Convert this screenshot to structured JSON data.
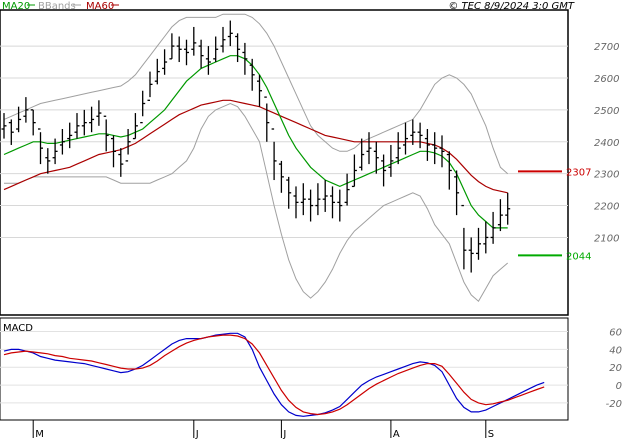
{
  "header": {
    "legend": [
      {
        "name": "MA20",
        "color": "#009900"
      },
      {
        "name": "BBands",
        "color": "#a0a0a0"
      },
      {
        "name": "MA60",
        "color": "#aa0000"
      }
    ],
    "copyright": "© TEC 8/9/2024 3:0 GMT"
  },
  "chart_data": [
    {
      "type": "line",
      "subtype": "ohlc",
      "x": [
        "M",
        "J",
        "J",
        "A",
        "S"
      ],
      "x_label_positions": [
        4,
        26,
        38,
        53,
        66
      ],
      "n_bars": 70,
      "ylim": [
        1860,
        2810
      ],
      "y_ticks": [
        2100,
        2200,
        2300,
        2400,
        2500,
        2600,
        2700
      ],
      "y_tick_labels": [
        "2100",
        "2200",
        "2300",
        "2400",
        "2500",
        "2600",
        "2700"
      ],
      "close": [
        2450,
        2430,
        2470,
        2500,
        2460,
        2380,
        2340,
        2370,
        2400,
        2420,
        2450,
        2460,
        2470,
        2490,
        2420,
        2370,
        2330,
        2400,
        2450,
        2520,
        2580,
        2620,
        2650,
        2700,
        2690,
        2680,
        2710,
        2670,
        2650,
        2690,
        2720,
        2740,
        2690,
        2660,
        2610,
        2560,
        2460,
        2340,
        2290,
        2240,
        2210,
        2220,
        2200,
        2220,
        2230,
        2210,
        2200,
        2250,
        2310,
        2360,
        2380,
        2350,
        2310,
        2340,
        2380,
        2410,
        2430,
        2420,
        2390,
        2380,
        2370,
        2310,
        2240,
        2060,
        2050,
        2080,
        2100,
        2130,
        2170,
        2190
      ],
      "high": [
        2490,
        2470,
        2510,
        2540,
        2500,
        2430,
        2380,
        2410,
        2440,
        2460,
        2490,
        2500,
        2510,
        2530,
        2470,
        2420,
        2380,
        2440,
        2490,
        2560,
        2620,
        2660,
        2690,
        2740,
        2730,
        2720,
        2760,
        2720,
        2700,
        2730,
        2760,
        2780,
        2740,
        2710,
        2660,
        2610,
        2520,
        2400,
        2340,
        2290,
        2260,
        2270,
        2250,
        2270,
        2280,
        2260,
        2250,
        2300,
        2360,
        2410,
        2430,
        2400,
        2360,
        2390,
        2430,
        2460,
        2470,
        2460,
        2440,
        2430,
        2420,
        2370,
        2310,
        2130,
        2100,
        2130,
        2150,
        2180,
        2220,
        2240
      ],
      "low": [
        2410,
        2390,
        2430,
        2460,
        2420,
        2330,
        2300,
        2330,
        2360,
        2380,
        2410,
        2420,
        2430,
        2450,
        2370,
        2320,
        2290,
        2360,
        2410,
        2480,
        2540,
        2580,
        2610,
        2660,
        2650,
        2640,
        2670,
        2630,
        2610,
        2650,
        2680,
        2700,
        2650,
        2610,
        2560,
        2510,
        2400,
        2280,
        2240,
        2190,
        2160,
        2170,
        2150,
        2170,
        2180,
        2160,
        2150,
        2200,
        2260,
        2310,
        2330,
        2300,
        2260,
        2290,
        2330,
        2360,
        2390,
        2380,
        2340,
        2330,
        2320,
        2250,
        2170,
        2000,
        1990,
        2030,
        2050,
        2080,
        2120,
        2140
      ],
      "open": [
        2440,
        2460,
        2440,
        2480,
        2500,
        2440,
        2350,
        2350,
        2390,
        2410,
        2430,
        2450,
        2460,
        2480,
        2480,
        2410,
        2360,
        2340,
        2410,
        2460,
        2530,
        2590,
        2630,
        2660,
        2700,
        2690,
        2690,
        2700,
        2660,
        2660,
        2700,
        2730,
        2730,
        2680,
        2640,
        2590,
        2540,
        2440,
        2330,
        2280,
        2230,
        2210,
        2220,
        2200,
        2220,
        2230,
        2210,
        2210,
        2260,
        2320,
        2370,
        2370,
        2340,
        2320,
        2350,
        2390,
        2420,
        2430,
        2410,
        2390,
        2380,
        2360,
        2290,
        2200,
        2060,
        2050,
        2080,
        2100,
        2140,
        2170
      ],
      "ma20": [
        2360,
        2370,
        2380,
        2390,
        2400,
        2400,
        2395,
        2395,
        2400,
        2405,
        2410,
        2415,
        2420,
        2425,
        2425,
        2420,
        2415,
        2420,
        2430,
        2440,
        2460,
        2480,
        2500,
        2530,
        2560,
        2590,
        2610,
        2630,
        2640,
        2650,
        2660,
        2670,
        2670,
        2660,
        2640,
        2610,
        2570,
        2520,
        2470,
        2420,
        2380,
        2350,
        2320,
        2300,
        2280,
        2270,
        2260,
        2270,
        2280,
        2290,
        2300,
        2310,
        2320,
        2330,
        2340,
        2350,
        2360,
        2370,
        2370,
        2365,
        2355,
        2335,
        2300,
        2250,
        2200,
        2170,
        2150,
        2130,
        2130,
        2130
      ],
      "ma60": [
        2250,
        2260,
        2270,
        2280,
        2290,
        2300,
        2305,
        2310,
        2315,
        2320,
        2330,
        2340,
        2350,
        2360,
        2365,
        2370,
        2375,
        2385,
        2395,
        2410,
        2425,
        2440,
        2455,
        2470,
        2485,
        2495,
        2505,
        2515,
        2520,
        2525,
        2530,
        2530,
        2525,
        2520,
        2515,
        2510,
        2500,
        2490,
        2480,
        2470,
        2460,
        2450,
        2440,
        2430,
        2420,
        2415,
        2410,
        2405,
        2400,
        2400,
        2400,
        2400,
        2400,
        2400,
        2400,
        2400,
        2400,
        2400,
        2395,
        2390,
        2380,
        2365,
        2345,
        2320,
        2295,
        2275,
        2260,
        2250,
        2245,
        2240
      ],
      "bb_upper": [
        2470,
        2480,
        2490,
        2500,
        2510,
        2520,
        2525,
        2530,
        2535,
        2540,
        2545,
        2550,
        2555,
        2560,
        2565,
        2570,
        2575,
        2590,
        2610,
        2640,
        2670,
        2700,
        2730,
        2760,
        2780,
        2790,
        2790,
        2790,
        2790,
        2790,
        2800,
        2800,
        2800,
        2800,
        2790,
        2770,
        2740,
        2700,
        2650,
        2600,
        2550,
        2500,
        2450,
        2420,
        2400,
        2380,
        2370,
        2370,
        2380,
        2400,
        2410,
        2420,
        2430,
        2440,
        2450,
        2460,
        2470,
        2500,
        2540,
        2580,
        2600,
        2610,
        2600,
        2580,
        2550,
        2500,
        2450,
        2380,
        2320,
        2300
      ],
      "bb_lower": [
        2270,
        2270,
        2270,
        2280,
        2290,
        2290,
        2290,
        2290,
        2290,
        2290,
        2290,
        2290,
        2290,
        2290,
        2290,
        2280,
        2270,
        2270,
        2270,
        2270,
        2270,
        2280,
        2290,
        2300,
        2320,
        2340,
        2380,
        2440,
        2480,
        2500,
        2510,
        2520,
        2510,
        2480,
        2440,
        2400,
        2300,
        2200,
        2110,
        2030,
        1970,
        1930,
        1910,
        1930,
        1960,
        2000,
        2050,
        2090,
        2120,
        2140,
        2160,
        2180,
        2200,
        2210,
        2220,
        2230,
        2240,
        2230,
        2190,
        2140,
        2110,
        2080,
        2020,
        1960,
        1920,
        1900,
        1940,
        1980,
        2000,
        2020
      ],
      "markers": [
        {
          "label": "2307",
          "value": 2307,
          "color": "#cc0000"
        },
        {
          "label": "2044",
          "value": 2044,
          "color": "#00aa00"
        }
      ]
    },
    {
      "type": "line",
      "title": "MACD",
      "ylim": [
        -38,
        74
      ],
      "y_ticks": [
        60,
        40,
        20,
        0,
        -20
      ],
      "y_tick_labels": [
        "60",
        "40",
        "20",
        "0",
        "-20"
      ],
      "series": [
        {
          "name": "",
          "color": "#0000cc",
          "values": [
            38,
            40,
            40,
            38,
            36,
            32,
            30,
            28,
            27,
            26,
            25,
            24,
            22,
            20,
            18,
            16,
            14,
            15,
            18,
            22,
            28,
            34,
            40,
            46,
            50,
            52,
            52,
            52,
            54,
            56,
            57,
            58,
            58,
            54,
            40,
            20,
            5,
            -10,
            -22,
            -30,
            -34,
            -35,
            -34,
            -33,
            -31,
            -28,
            -24,
            -16,
            -8,
            0,
            5,
            9,
            12,
            15,
            18,
            21,
            24,
            26,
            25,
            22,
            15,
            0,
            -15,
            -25,
            -30,
            -30,
            -28,
            -24,
            -20,
            -16,
            -12,
            -8,
            -4,
            0,
            3
          ]
        },
        {
          "name": "",
          "color": "#cc0000",
          "values": [
            34,
            36,
            37,
            38,
            37,
            36,
            35,
            33,
            32,
            30,
            29,
            28,
            27,
            25,
            23,
            21,
            19,
            18,
            18,
            19,
            22,
            27,
            33,
            38,
            43,
            47,
            50,
            52,
            54,
            55,
            56,
            56,
            55,
            52,
            46,
            36,
            22,
            8,
            -6,
            -17,
            -25,
            -30,
            -32,
            -33,
            -32,
            -30,
            -27,
            -22,
            -16,
            -10,
            -4,
            1,
            5,
            9,
            13,
            16,
            19,
            22,
            24,
            24,
            21,
            12,
            2,
            -8,
            -16,
            -20,
            -22,
            -21,
            -19,
            -17,
            -14,
            -11,
            -8,
            -5,
            -2
          ]
        }
      ]
    }
  ]
}
